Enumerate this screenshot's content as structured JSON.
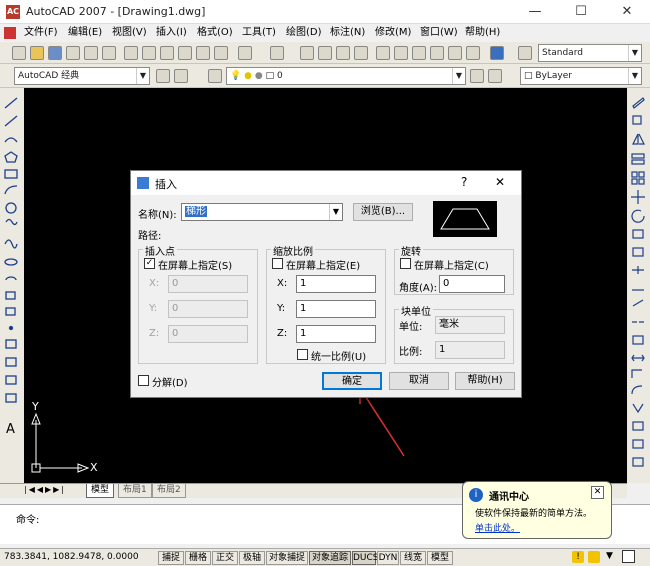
{
  "window": {
    "title": "AutoCAD 2007 - [Drawing1.dwg]",
    "app_badge": "AC",
    "minimize": "—",
    "maximize": "☐",
    "close": "✕"
  },
  "menu": [
    "文件(F)",
    "编辑(E)",
    "视图(V)",
    "插入(I)",
    "格式(O)",
    "工具(T)",
    "绘图(D)",
    "标注(N)",
    "修改(M)",
    "窗口(W)",
    "帮助(H)"
  ],
  "toolbar": {
    "text_style": "Standard",
    "workspace": "AutoCAD 经典",
    "layer": "0",
    "linetype": "ByLayer"
  },
  "dialog": {
    "title": "插入",
    "help": "?",
    "close": "✕",
    "name_label": "名称(N):",
    "name_value": "梯形",
    "browse": "浏览(B)...",
    "path_label": "路径:",
    "insertion_point": {
      "title": "插入点",
      "specify": "在屏幕上指定(S)",
      "checked": "✓",
      "x_label": "X:",
      "y_label": "Y:",
      "z_label": "Z:",
      "x": "0",
      "y": "0",
      "z": "0"
    },
    "scale": {
      "title": "缩放比例",
      "specify": "在屏幕上指定(E)",
      "x_label": "X:",
      "y_label": "Y:",
      "z_label": "Z:",
      "x": "1",
      "y": "1",
      "z": "1",
      "uniform": "统一比例(U)"
    },
    "rotation": {
      "title": "旋转",
      "specify": "在屏幕上指定(C)",
      "angle_label": "角度(A):",
      "angle": "0"
    },
    "block_unit": {
      "title": "块单位",
      "unit_label": "单位:",
      "unit": "毫米",
      "factor_label": "比例:",
      "factor": "1"
    },
    "explode": "分解(D)",
    "ok": "确定",
    "cancel": "取消",
    "help_btn": "帮助(H)"
  },
  "canvas": {
    "x_axis": "X",
    "y_axis": "Y"
  },
  "tabs": {
    "model": "模型",
    "layout1": "布局1",
    "layout2": "布局2"
  },
  "command": {
    "prompt": "命令:"
  },
  "balloon": {
    "title": "通讯中心",
    "text": "使软件保持最新的简单方法。",
    "link": "单击此处。",
    "close": "✕"
  },
  "status": {
    "coords": "783.3841,  1082.9478, 0.0000",
    "buttons": [
      "捕捉",
      "栅格",
      "正交",
      "极轴",
      "对象捕捉",
      "对象追踪",
      "DUCS",
      "DYN",
      "线宽",
      "模型"
    ]
  },
  "colors": {
    "canvas": "#000000",
    "arrow": "#d03030",
    "link": "#0033cc"
  }
}
